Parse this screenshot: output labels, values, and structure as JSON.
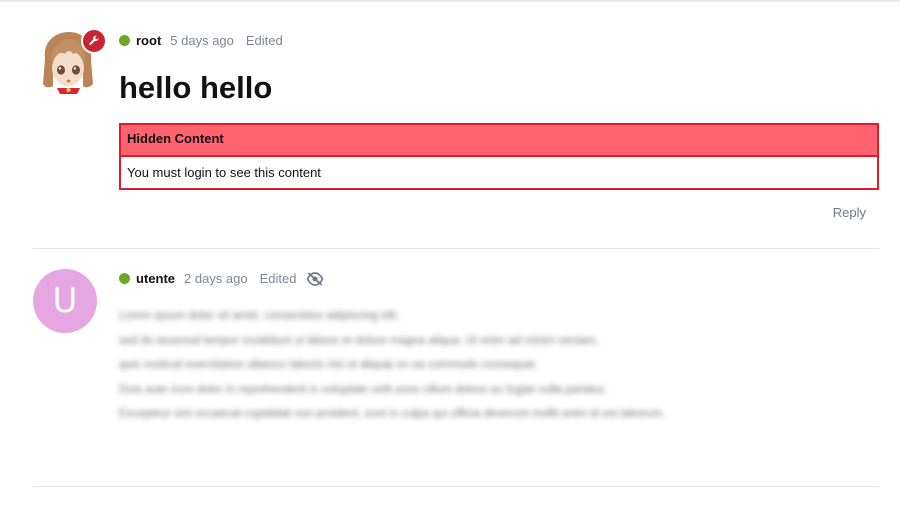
{
  "posts": [
    {
      "username": "root",
      "time": "5 days ago",
      "edited": "Edited",
      "title": "hello hello",
      "hidden_content": {
        "heading": "Hidden Content",
        "message": "You must login to see this content"
      },
      "reply_label": "Reply",
      "badge_icon": "wrench-icon"
    },
    {
      "username": "utente",
      "avatar_letter": "U",
      "time": "2 days ago",
      "edited": "Edited",
      "visibility_icon": "eye-off-icon",
      "blurred_lines": [
        "Lorem ipsum dolor sit amet, consectetur adipiscing elit,",
        "sed do eiusmod tempor incididunt ut labore et dolore magna aliqua. Ut enim ad minim veniam,",
        "quis nostrud exercitation ullamco laboris nisi ut aliquip ex ea commodo consequat.",
        "Duis aute irure dolor in reprehenderit in voluptate velit esse cillum dolore eu fugiat nulla pariatur.",
        "Excepteur sint occaecat cupidatat non proident, sunt in culpa qui officia deserunt mollit anim id est laborum."
      ]
    }
  ],
  "colors": {
    "online": "#6aa924",
    "hidden_border": "#e01b2c",
    "hidden_header_bg": "#ff6370",
    "avatar_letter_bg": "#e5a6e1",
    "mod_badge": "#c6262e"
  }
}
